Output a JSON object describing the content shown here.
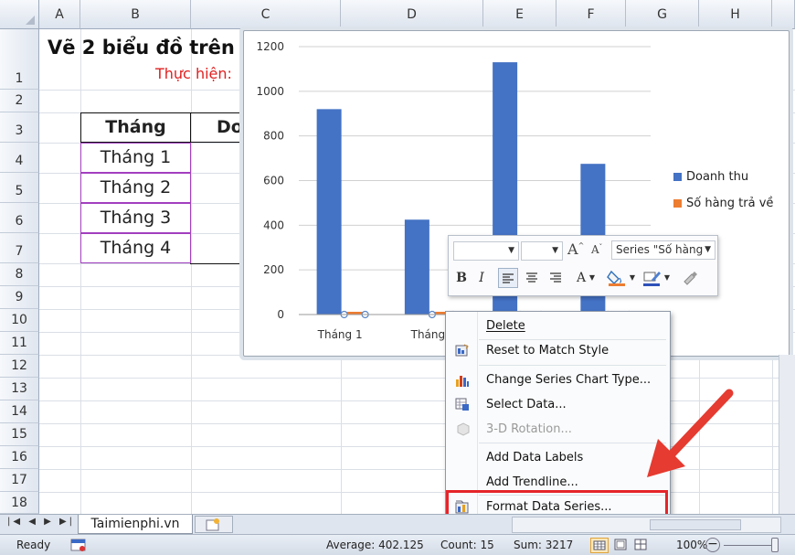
{
  "columns": [
    "A",
    "B",
    "C",
    "D",
    "E",
    "F",
    "G",
    "H"
  ],
  "rows": [
    "1",
    "2",
    "3",
    "4",
    "5",
    "6",
    "7",
    "8",
    "9",
    "10",
    "11",
    "12",
    "13",
    "14",
    "15",
    "16",
    "17",
    "18"
  ],
  "title": "Vẽ 2 biểu đồ trên",
  "subtitle": "Thực hiện:",
  "table": {
    "header": "Tháng",
    "header2": "Do",
    "months": [
      "Tháng 1",
      "Tháng 2",
      "Tháng 3",
      "Tháng 4"
    ]
  },
  "chart_data": {
    "type": "bar",
    "categories": [
      "Tháng 1",
      "Tháng 2",
      "Tháng 3",
      "Tháng 4"
    ],
    "category_labels_visible": [
      "Tháng 1",
      "Tháng"
    ],
    "series": [
      {
        "name": "Doanh thu",
        "values": [
          920,
          425,
          1130,
          675
        ],
        "color": "#4472c4"
      },
      {
        "name": "Số hàng trả về",
        "values": [
          5,
          3,
          4,
          2
        ],
        "color": "#ed7d31"
      }
    ],
    "yticks": [
      "0",
      "200",
      "400",
      "600",
      "800",
      "1000",
      "1200"
    ],
    "ylim": [
      0,
      1200
    ],
    "grid": true,
    "legend_position": "right"
  },
  "minitoolbar": {
    "series_select": "Series \"Số hàng",
    "font_grow": "A",
    "font_shrink": "A",
    "bold": "B",
    "italic": "I",
    "font_color": "A"
  },
  "context_menu": {
    "items": [
      {
        "label": "Delete",
        "icon": "none",
        "enabled": true
      },
      {
        "label": "Reset to Match Style",
        "icon": "reset-style-icon",
        "enabled": true
      },
      {
        "label": "Change Series Chart Type...",
        "icon": "chart-type-icon",
        "enabled": true
      },
      {
        "label": "Select Data...",
        "icon": "select-data-icon",
        "enabled": true
      },
      {
        "label": "3-D Rotation...",
        "icon": "rotation-icon",
        "enabled": false
      },
      {
        "label": "Add Data Labels",
        "icon": "none",
        "enabled": true
      },
      {
        "label": "Add Trendline...",
        "icon": "none",
        "enabled": true
      },
      {
        "label": "Format Data Series...",
        "icon": "format-series-icon",
        "enabled": true
      }
    ]
  },
  "sheet_tab": "Taimienphi.vn",
  "status": {
    "mode": "Ready",
    "average": "Average: 402.125",
    "count": "Count: 15",
    "sum": "Sum: 3217",
    "zoom": "100%"
  },
  "colors": {
    "highlight": "#e5252a",
    "arrow": "#e53b30",
    "title_red": "#e02020",
    "selection": "#a23fbf"
  }
}
